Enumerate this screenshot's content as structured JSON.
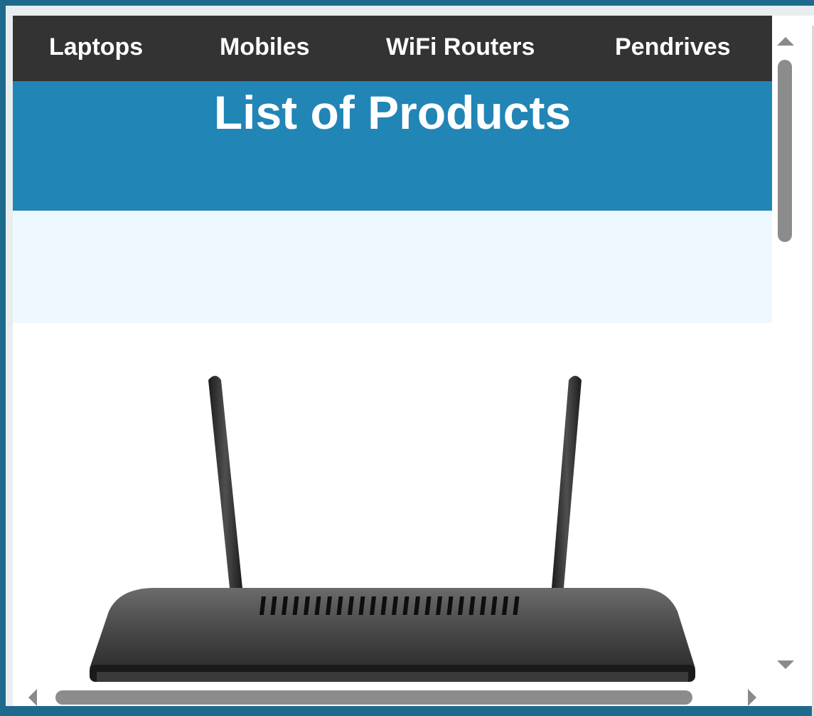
{
  "nav": {
    "items": [
      {
        "label": "Laptops"
      },
      {
        "label": "Mobiles"
      },
      {
        "label": "WiFi Routers"
      },
      {
        "label": "Pendrives"
      }
    ]
  },
  "banner": {
    "title": "List of Products"
  },
  "product": {
    "image_icon": "wifi-router-icon"
  },
  "colors": {
    "nav_bg": "#333333",
    "banner_bg": "#2185b5",
    "light_band": "#eef8ff",
    "window_border": "#1e6a8c"
  }
}
